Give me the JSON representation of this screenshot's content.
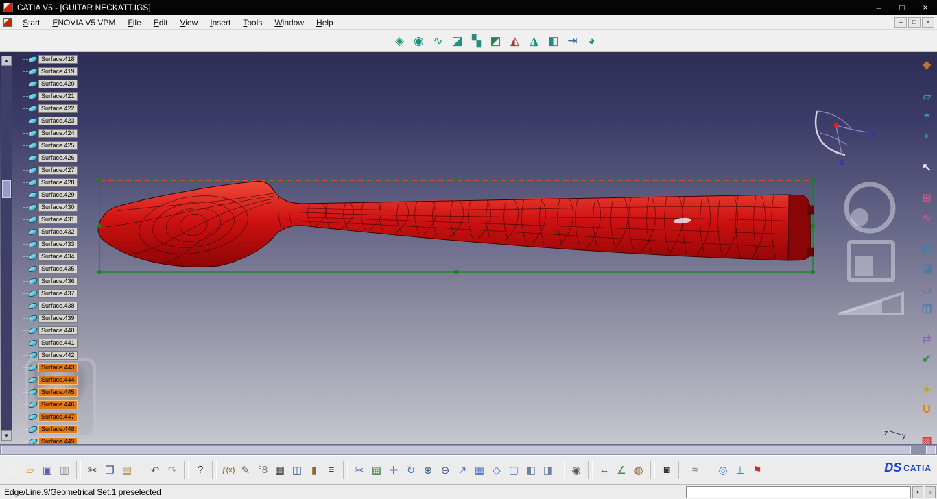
{
  "window": {
    "title": "CATIA V5 - [GUITAR NECKATT.IGS]",
    "controls": [
      {
        "name": "minimize-button",
        "glyph": "–"
      },
      {
        "name": "maximize-button",
        "glyph": "□"
      },
      {
        "name": "close-button",
        "glyph": "×"
      }
    ]
  },
  "menu_bar": {
    "items": [
      "Start",
      "ENOVIA V5 VPM",
      "File",
      "Edit",
      "View",
      "Insert",
      "Tools",
      "Window",
      "Help"
    ],
    "mdi_controls": [
      {
        "name": "mdi-minimize-button",
        "glyph": "–"
      },
      {
        "name": "mdi-restore-button",
        "glyph": "□"
      },
      {
        "name": "mdi-close-button",
        "glyph": "×"
      }
    ]
  },
  "top_toolbar": {
    "icons": [
      {
        "name": "join-icon",
        "glyph": "◈",
        "color": "#1f8f7f"
      },
      {
        "name": "healing-icon",
        "glyph": "◉",
        "color": "#1f8f7f"
      },
      {
        "name": "curve-smooth-icon",
        "glyph": "∿",
        "color": "#1f8f7f"
      },
      {
        "name": "untrim-icon",
        "glyph": "◪",
        "color": "#1f8f7f"
      },
      {
        "name": "disassemble-icon",
        "glyph": "▚",
        "color": "#1f8f7f"
      },
      {
        "name": "split-icon",
        "glyph": "◩",
        "color": "#2f7f4f"
      },
      {
        "name": "trim-icon",
        "glyph": "◭",
        "color": "#b03030"
      },
      {
        "name": "boundary-icon",
        "glyph": "◮",
        "color": "#1f8f7f"
      },
      {
        "name": "extract-icon",
        "glyph": "◧",
        "color": "#1f8f7f"
      },
      {
        "name": "multiple-extract-icon",
        "glyph": "⇥",
        "color": "#2f6f9f"
      },
      {
        "name": "extrapolate-icon",
        "glyph": "◕",
        "color": "#1f8f7f"
      }
    ]
  },
  "tree": {
    "items": [
      {
        "label": "Surface.418",
        "selected": false
      },
      {
        "label": "Surface.419",
        "selected": false
      },
      {
        "label": "Surface.420",
        "selected": false
      },
      {
        "label": "Surface.421",
        "selected": false
      },
      {
        "label": "Surface.422",
        "selected": false
      },
      {
        "label": "Surface.423",
        "selected": false
      },
      {
        "label": "Surface.424",
        "selected": false
      },
      {
        "label": "Surface.425",
        "selected": false
      },
      {
        "label": "Surface.426",
        "selected": false
      },
      {
        "label": "Surface.427",
        "selected": false
      },
      {
        "label": "Surface.428",
        "selected": false
      },
      {
        "label": "Surface.429",
        "selected": false
      },
      {
        "label": "Surface.430",
        "selected": false
      },
      {
        "label": "Surface.431",
        "selected": false
      },
      {
        "label": "Surface.432",
        "selected": false
      },
      {
        "label": "Surface.433",
        "selected": false
      },
      {
        "label": "Surface.434",
        "selected": false
      },
      {
        "label": "Surface.435",
        "selected": false
      },
      {
        "label": "Surface.436",
        "selected": false
      },
      {
        "label": "Surface.437",
        "selected": false
      },
      {
        "label": "Surface.438",
        "selected": false
      },
      {
        "label": "Surface.439",
        "selected": false
      },
      {
        "label": "Surface.440",
        "selected": false
      },
      {
        "label": "Surface.441",
        "selected": false
      },
      {
        "label": "Surface.442",
        "selected": false
      },
      {
        "label": "Surface.443",
        "selected": true
      },
      {
        "label": "Surface.444",
        "selected": true
      },
      {
        "label": "Surface.445",
        "selected": true
      },
      {
        "label": "Surface.446",
        "selected": true
      },
      {
        "label": "Surface.447",
        "selected": true
      },
      {
        "label": "Surface.448",
        "selected": true
      },
      {
        "label": "Surface.449",
        "selected": true
      }
    ]
  },
  "right_toolbar": {
    "groups": [
      [
        {
          "name": "paint-style-icon",
          "glyph": "❖",
          "color": "#c87030"
        }
      ],
      [
        {
          "name": "planar-patch-icon",
          "glyph": "▱",
          "color": "#2f9fae"
        },
        {
          "name": "extrude-surface-icon",
          "glyph": "◓",
          "color": "#2f9fae"
        },
        {
          "name": "revolve-surface-icon",
          "glyph": "◗",
          "color": "#2f9fae"
        }
      ],
      [
        {
          "name": "select-arrow-icon",
          "glyph": "↖",
          "color": "#f8f8f8"
        }
      ],
      [
        {
          "name": "control-points-icon",
          "glyph": "⊞",
          "color": "#c05a8a"
        },
        {
          "name": "match-surface-icon",
          "glyph": "∿",
          "color": "#c05a8a"
        }
      ],
      [
        {
          "name": "break-surface-icon",
          "glyph": "◩",
          "color": "#4a7aa8"
        },
        {
          "name": "untrim-surface-icon",
          "glyph": "◪",
          "color": "#4a7aa8"
        },
        {
          "name": "concatenate-icon",
          "glyph": "◡",
          "color": "#4a7aa8"
        },
        {
          "name": "fragmentation-icon",
          "glyph": "◫",
          "color": "#4a7aa8"
        }
      ],
      [
        {
          "name": "symmetry-icon",
          "glyph": "⇄",
          "color": "#8a6ab0"
        },
        {
          "name": "connect-checker-icon",
          "glyph": "✔",
          "color": "#2f8f4f"
        }
      ],
      [
        {
          "name": "styling-constraint-icon",
          "glyph": "✦",
          "color": "#c8a028"
        },
        {
          "name": "u-workbench-icon",
          "glyph": "U",
          "color": "#e08000"
        }
      ],
      [
        {
          "name": "apply-dress-icon",
          "glyph": "▨",
          "color": "#c04040"
        },
        {
          "name": "painter-icon",
          "glyph": "✎",
          "color": "#2f8f4f"
        }
      ]
    ]
  },
  "bottom_toolbar": {
    "groups": [
      [
        {
          "name": "new-document-icon",
          "glyph": "▯",
          "color": "#f5f5f5"
        },
        {
          "name": "open-icon",
          "glyph": "▱",
          "color": "#d9a520"
        },
        {
          "name": "save-icon",
          "glyph": "▣",
          "color": "#5b5bb0"
        },
        {
          "name": "print-icon",
          "glyph": "▥",
          "color": "#8a8a95"
        }
      ],
      [
        {
          "name": "cut-icon",
          "glyph": "✂",
          "color": "#444444"
        },
        {
          "name": "copy-icon",
          "glyph": "❐",
          "color": "#44518a"
        },
        {
          "name": "paste-icon",
          "glyph": "▤",
          "color": "#b08a3e"
        }
      ],
      [
        {
          "name": "undo-icon",
          "glyph": "↶",
          "color": "#2f54c0"
        },
        {
          "name": "redo-icon",
          "glyph": "↷",
          "color": "#8a93a8"
        }
      ],
      [
        {
          "name": "whats-this-icon",
          "glyph": "?",
          "color": "#1e1e1e"
        }
      ],
      [
        {
          "name": "formula-icon",
          "glyph": "ƒ(x)",
          "color": "#7a5a1e"
        },
        {
          "name": "annotation-icon",
          "glyph": "✎",
          "color": "#56616e"
        },
        {
          "name": "parameters-icon",
          "glyph": "°8",
          "color": "#777777"
        },
        {
          "name": "design-table-icon",
          "glyph": "▦",
          "color": "#3f3f3f"
        },
        {
          "name": "grid-snap-icon",
          "glyph": "◫",
          "color": "#3f5f8f"
        },
        {
          "name": "lock-icon",
          "glyph": "▮",
          "color": "#8a6a2a"
        },
        {
          "name": "catalog-icon",
          "glyph": "≡",
          "color": "#444444"
        }
      ],
      [
        {
          "name": "split-view-icon",
          "glyph": "✂",
          "color": "#3f6fbf"
        },
        {
          "name": "selection-filter-icon",
          "glyph": "▧",
          "color": "#2f7f3f"
        },
        {
          "name": "pan-icon",
          "glyph": "✛",
          "color": "#2f54c0"
        },
        {
          "name": "rotate-icon",
          "glyph": "↻",
          "color": "#3f6fbf"
        },
        {
          "name": "zoom-in-icon",
          "glyph": "⊕",
          "color": "#33527f"
        },
        {
          "name": "zoom-out-icon",
          "glyph": "⊖",
          "color": "#33527f"
        },
        {
          "name": "normal-view-icon",
          "glyph": "↗",
          "color": "#3f6fbf"
        },
        {
          "name": "multi-view-icon",
          "glyph": "▦",
          "color": "#3f6fbf"
        },
        {
          "name": "iso-view-icon",
          "glyph": "◇",
          "color": "#3f6fbf"
        },
        {
          "name": "shading-icon",
          "glyph": "▢",
          "color": "#4f7fbf"
        },
        {
          "name": "hidden-line-icon",
          "glyph": "◧",
          "color": "#6f7f9f"
        },
        {
          "name": "wireframe-icon",
          "glyph": "◨",
          "color": "#6f7f9f"
        }
      ],
      [
        {
          "name": "turntable-icon",
          "glyph": "◉",
          "color": "#555555"
        }
      ],
      [
        {
          "name": "measure-between-icon",
          "glyph": "↔",
          "color": "#2f54c0"
        },
        {
          "name": "measure-item-icon",
          "glyph": "∠",
          "color": "#2f8f4f"
        },
        {
          "name": "apply-material-icon",
          "glyph": "◍",
          "color": "#8a5a2a"
        }
      ],
      [
        {
          "name": "capture-icon",
          "glyph": "◙",
          "color": "#333333"
        }
      ],
      [
        {
          "name": "wave-analysis-icon",
          "glyph": "≈",
          "color": "#777777"
        }
      ],
      [
        {
          "name": "browser-icon",
          "glyph": "◎",
          "color": "#2f6fbf"
        },
        {
          "name": "axis-system-icon",
          "glyph": "⊥",
          "color": "#3f6fbf"
        },
        {
          "name": "flag-note-icon",
          "glyph": "⚑",
          "color": "#c03030"
        }
      ]
    ]
  },
  "brand": {
    "ds": "DS",
    "name": "CATIA"
  },
  "status_bar": {
    "message": "Edge/Line.9/Geometrical Set.1 preselected",
    "input_value": "",
    "buttons": [
      {
        "name": "status-lock-button",
        "glyph": "▪"
      },
      {
        "name": "status-help-button",
        "glyph": "▫"
      }
    ]
  },
  "compass": {
    "x_label": "x",
    "y_label": "y"
  },
  "axis_indicator": {
    "z_label": "z",
    "y_label": "y"
  },
  "scrollbars": {
    "tree_up": "▲",
    "tree_down": "▼"
  },
  "colors": {
    "model_red": "#cf1212",
    "selection_green": "#0c8a0c",
    "highlight_orange": "#e07818",
    "viewport_top": "#2d2d55",
    "viewport_bottom": "#c7c7ce"
  }
}
